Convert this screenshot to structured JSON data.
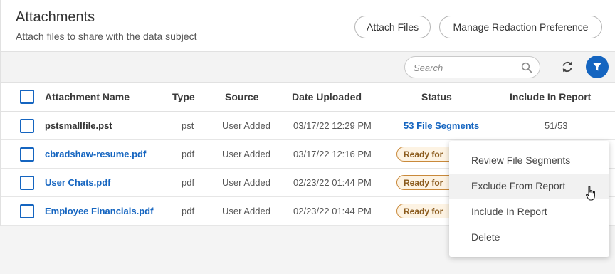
{
  "header": {
    "title": "Attachments",
    "subtitle": "Attach files to share with the data subject",
    "attach_label": "Attach Files",
    "manage_label": "Manage Redaction Preference"
  },
  "toolbar": {
    "search_placeholder": "Search",
    "search_icon": "search-icon",
    "refresh_icon": "refresh-icon",
    "filter_icon": "filter-icon"
  },
  "columns": {
    "name": "Attachment Name",
    "type": "Type",
    "source": "Source",
    "date": "Date Uploaded",
    "status": "Status",
    "include": "Include In Report"
  },
  "rows": [
    {
      "name": "pstsmallfile.pst",
      "type": "pst",
      "source": "User Added",
      "date": "03/17/22 12:29 PM",
      "status": "53 File Segments",
      "include": "51/53"
    },
    {
      "name": "cbradshaw-resume.pdf",
      "type": "pdf",
      "source": "User Added",
      "date": "03/17/22 12:16 PM",
      "status": "Ready for",
      "include": ""
    },
    {
      "name": "User Chats.pdf",
      "type": "pdf",
      "source": "User Added",
      "date": "02/23/22 01:44 PM",
      "status": "Ready for",
      "include": ""
    },
    {
      "name": "Employee Financials.pdf",
      "type": "pdf",
      "source": "User Added",
      "date": "02/23/22 01:44 PM",
      "status": "Ready for",
      "include": ""
    }
  ],
  "context_menu": {
    "items": [
      {
        "label": "Review File Segments"
      },
      {
        "label": "Exclude From Report"
      },
      {
        "label": "Include In Report"
      },
      {
        "label": "Delete"
      }
    ],
    "hovered_item": "Exclude From Report"
  },
  "colors": {
    "accent": "#1565c0",
    "badge_border": "#c9893a",
    "badge_bg": "#fdf3e3"
  }
}
